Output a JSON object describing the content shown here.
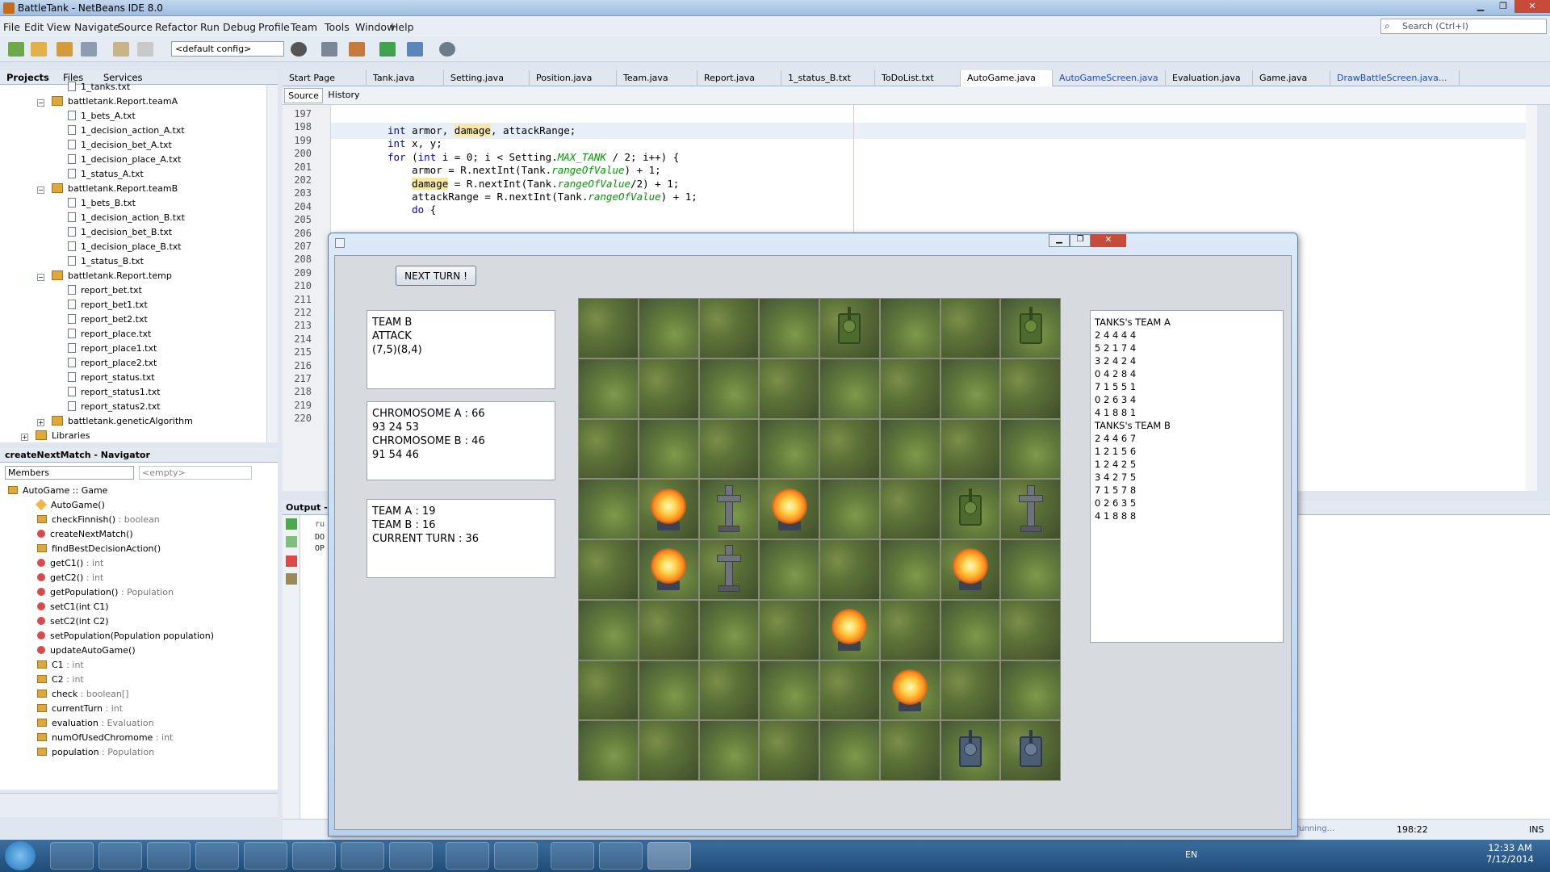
{
  "window": {
    "title": "BattleTank - NetBeans IDE 8.0"
  },
  "menu": [
    "File",
    "Edit",
    "View",
    "Navigate",
    "Source",
    "Refactor",
    "Run",
    "Debug",
    "Profile",
    "Team",
    "Tools",
    "Window",
    "Help"
  ],
  "search": {
    "placeholder": "Search (Ctrl+I)"
  },
  "toolbar": {
    "config": "<default config>"
  },
  "projects": {
    "tabs": [
      "Projects",
      "Files",
      "Services"
    ],
    "tree": [
      {
        "label": "1_tanks.txt",
        "kind": "file",
        "level": 3
      },
      {
        "label": "battletank.Report.teamA",
        "kind": "package",
        "level": 2
      },
      {
        "label": "1_bets_A.txt",
        "kind": "file",
        "level": 3
      },
      {
        "label": "1_decision_action_A.txt",
        "kind": "file",
        "level": 3
      },
      {
        "label": "1_decision_bet_A.txt",
        "kind": "file",
        "level": 3
      },
      {
        "label": "1_decision_place_A.txt",
        "kind": "file",
        "level": 3
      },
      {
        "label": "1_status_A.txt",
        "kind": "file",
        "level": 3
      },
      {
        "label": "battletank.Report.teamB",
        "kind": "package",
        "level": 2
      },
      {
        "label": "1_bets_B.txt",
        "kind": "file",
        "level": 3
      },
      {
        "label": "1_decision_action_B.txt",
        "kind": "file",
        "level": 3
      },
      {
        "label": "1_decision_bet_B.txt",
        "kind": "file",
        "level": 3
      },
      {
        "label": "1_decision_place_B.txt",
        "kind": "file",
        "level": 3
      },
      {
        "label": "1_status_B.txt",
        "kind": "file",
        "level": 3
      },
      {
        "label": "battletank.Report.temp",
        "kind": "package",
        "level": 2
      },
      {
        "label": "report_bet.txt",
        "kind": "file",
        "level": 3
      },
      {
        "label": "report_bet1.txt",
        "kind": "file",
        "level": 3
      },
      {
        "label": "report_bet2.txt",
        "kind": "file",
        "level": 3
      },
      {
        "label": "report_place.txt",
        "kind": "file",
        "level": 3
      },
      {
        "label": "report_place1.txt",
        "kind": "file",
        "level": 3
      },
      {
        "label": "report_place2.txt",
        "kind": "file",
        "level": 3
      },
      {
        "label": "report_status.txt",
        "kind": "file",
        "level": 3
      },
      {
        "label": "report_status1.txt",
        "kind": "file",
        "level": 3
      },
      {
        "label": "report_status2.txt",
        "kind": "file",
        "level": 3
      },
      {
        "label": "battletank.geneticAlgorithm",
        "kind": "package",
        "level": 2
      },
      {
        "label": "Libraries",
        "kind": "package",
        "level": 1
      }
    ]
  },
  "navigator": {
    "title": "createNextMatch - Navigator",
    "filter": "Members",
    "empty": "<empty>",
    "root": "AutoGame :: Game",
    "items": [
      {
        "name": "AutoGame()",
        "type": "",
        "kind": "ctor"
      },
      {
        "name": "checkFinnish()",
        "type": " : boolean",
        "kind": "field"
      },
      {
        "name": "createNextMatch()",
        "type": "",
        "kind": "method"
      },
      {
        "name": "findBestDecisionAction()",
        "type": "",
        "kind": "field"
      },
      {
        "name": "getC1()",
        "type": " : int",
        "kind": "method"
      },
      {
        "name": "getC2()",
        "type": " : int",
        "kind": "method"
      },
      {
        "name": "getPopulation()",
        "type": " : Population",
        "kind": "method"
      },
      {
        "name": "setC1(int C1)",
        "type": "",
        "kind": "method"
      },
      {
        "name": "setC2(int C2)",
        "type": "",
        "kind": "method"
      },
      {
        "name": "setPopulation(Population population)",
        "type": "",
        "kind": "method"
      },
      {
        "name": "updateAutoGame()",
        "type": "",
        "kind": "method"
      },
      {
        "name": "C1",
        "type": " : int",
        "kind": "field"
      },
      {
        "name": "C2",
        "type": " : int",
        "kind": "field"
      },
      {
        "name": "check",
        "type": " : boolean[]",
        "kind": "field"
      },
      {
        "name": "currentTurn",
        "type": " : int",
        "kind": "field"
      },
      {
        "name": "evaluation",
        "type": " : Evaluation",
        "kind": "field"
      },
      {
        "name": "numOfUsedChromome",
        "type": " : int",
        "kind": "field"
      },
      {
        "name": "population",
        "type": " : Population",
        "kind": "field"
      }
    ]
  },
  "editor": {
    "tabs": [
      {
        "label": "Start Page",
        "mod": false
      },
      {
        "label": "Tank.java",
        "mod": false
      },
      {
        "label": "Setting.java",
        "mod": false
      },
      {
        "label": "Position.java",
        "mod": false
      },
      {
        "label": "Team.java",
        "mod": false
      },
      {
        "label": "Report.java",
        "mod": false
      },
      {
        "label": "1_status_B.txt",
        "mod": false
      },
      {
        "label": "ToDoList.txt",
        "mod": false
      },
      {
        "label": "AutoGame.java",
        "mod": false,
        "active": true
      },
      {
        "label": "AutoGameScreen.java",
        "mod": true
      },
      {
        "label": "Evaluation.java",
        "mod": false
      },
      {
        "label": "Game.java",
        "mod": false
      },
      {
        "label": "DrawBattleScreen.java...",
        "mod": true
      }
    ],
    "source_label": "Source",
    "history_label": "History",
    "line_numbers": [
      "197",
      "198",
      "199",
      "200",
      "201",
      "202",
      "203",
      "204",
      "205",
      "206",
      "207",
      "208",
      "209",
      "210",
      "211",
      "212",
      "213",
      "214",
      "215",
      "216",
      "217",
      "218",
      "219",
      "220"
    ]
  },
  "output": {
    "title": "Output - B",
    "lines": [
      "ru",
      "DO",
      "OP"
    ]
  },
  "status": {
    "progress_text": "running...",
    "position": "198:22",
    "mode": "INS"
  },
  "taskbar": {
    "lang": "EN",
    "time": "12:33 AM",
    "date": "7/12/2014"
  },
  "game": {
    "next_turn": "NEXT TURN !",
    "action_box": [
      "TEAM B",
      "ATTACK",
      "(7,5)(8,4)"
    ],
    "chromosome_box": [
      "CHROMOSOME A : 66",
      "93 24 53",
      "CHROMOSOME B : 46",
      "91 54 46"
    ],
    "score_box": [
      "TEAM A : 19",
      "TEAM B : 16",
      "CURRENT TURN : 36"
    ],
    "tanks_panel": [
      "TANKS's TEAM A",
      "2 4 4 4 4",
      "5 2 1 7 4",
      "3 2 4 2 4",
      "0 4 2 8 4",
      "7 1 5 5 1",
      "0 2 6 3 4",
      "4 1 8 8 1",
      "TANKS's TEAM B",
      "2 4 4 6 7",
      "1 2 1 5 6",
      "1 2 4 2 5",
      "3 4 2 7 5",
      "7 1 5 7 8",
      "0 2 6 3 5",
      "4 1 8 8 8"
    ],
    "board": {
      "size": 8,
      "green_tanks": [
        [
          4,
          0
        ],
        [
          7,
          0
        ],
        [
          6,
          3
        ]
      ],
      "blue_tanks": [
        [
          6,
          7
        ],
        [
          7,
          7
        ]
      ],
      "graves": [
        [
          2,
          3
        ],
        [
          7,
          3
        ],
        [
          2,
          4
        ]
      ],
      "fires": [
        [
          1,
          3
        ],
        [
          3,
          3
        ],
        [
          1,
          4
        ],
        [
          6,
          4
        ],
        [
          4,
          5
        ],
        [
          5,
          6
        ]
      ]
    }
  }
}
